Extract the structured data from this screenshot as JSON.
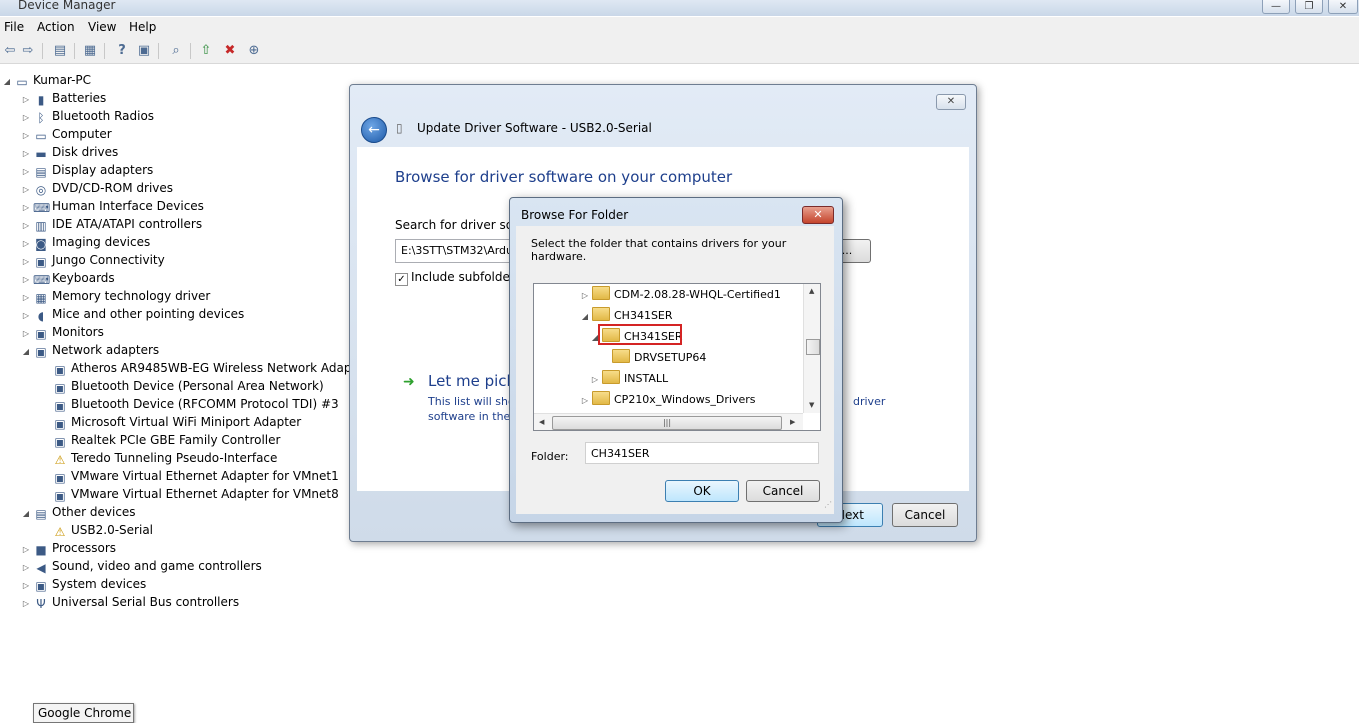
{
  "window": {
    "title": "Device Manager",
    "buttons": {
      "minimize": "—",
      "restore": "❐",
      "close": "✕"
    }
  },
  "menu": [
    "File",
    "Action",
    "View",
    "Help"
  ],
  "toolbar": {
    "icons": [
      "back-icon",
      "forward-icon",
      "properties-icon",
      "show-hidden-icon",
      "help-icon",
      "view-icon",
      "scan-hardware-icon",
      "update-driver-icon",
      "uninstall-icon",
      "enable-device-icon"
    ]
  },
  "tree": {
    "root": "Kumar-PC",
    "nodes": [
      {
        "label": "Batteries",
        "icon": "battery-icon",
        "expanded": false
      },
      {
        "label": "Bluetooth Radios",
        "icon": "bluetooth-icon",
        "expanded": false
      },
      {
        "label": "Computer",
        "icon": "computer-icon",
        "expanded": false
      },
      {
        "label": "Disk drives",
        "icon": "disk-drive-icon",
        "expanded": false
      },
      {
        "label": "Display adapters",
        "icon": "display-adapter-icon",
        "expanded": false
      },
      {
        "label": "DVD/CD-ROM drives",
        "icon": "dvd-drive-icon",
        "expanded": false
      },
      {
        "label": "Human Interface Devices",
        "icon": "hid-icon",
        "expanded": false
      },
      {
        "label": "IDE ATA/ATAPI controllers",
        "icon": "ide-controller-icon",
        "expanded": false
      },
      {
        "label": "Imaging devices",
        "icon": "camera-icon",
        "expanded": false
      },
      {
        "label": "Jungo Connectivity",
        "icon": "network-device-icon",
        "expanded": false
      },
      {
        "label": "Keyboards",
        "icon": "keyboard-icon",
        "expanded": false
      },
      {
        "label": "Memory technology driver",
        "icon": "memory-icon",
        "expanded": false
      },
      {
        "label": "Mice and other pointing devices",
        "icon": "mouse-icon",
        "expanded": false
      },
      {
        "label": "Monitors",
        "icon": "monitor-icon",
        "expanded": false
      },
      {
        "label": "Network adapters",
        "icon": "network-adapter-icon",
        "expanded": true,
        "children": [
          {
            "label": "Atheros AR9485WB-EG Wireless Network Adapter",
            "icon": "network-adapter-icon"
          },
          {
            "label": "Bluetooth Device (Personal Area Network)",
            "icon": "network-adapter-icon"
          },
          {
            "label": "Bluetooth Device (RFCOMM Protocol TDI) #3",
            "icon": "network-adapter-icon"
          },
          {
            "label": "Microsoft Virtual WiFi Miniport Adapter",
            "icon": "network-adapter-icon"
          },
          {
            "label": "Realtek PCIe GBE Family Controller",
            "icon": "network-adapter-icon"
          },
          {
            "label": "Teredo Tunneling Pseudo-Interface",
            "icon": "warning-device-icon"
          },
          {
            "label": "VMware Virtual Ethernet Adapter for VMnet1",
            "icon": "network-adapter-icon"
          },
          {
            "label": "VMware Virtual Ethernet Adapter for VMnet8",
            "icon": "network-adapter-icon"
          }
        ]
      },
      {
        "label": "Other devices",
        "icon": "other-devices-icon",
        "expanded": true,
        "children": [
          {
            "label": "USB2.0-Serial",
            "icon": "warning-device-icon"
          }
        ]
      },
      {
        "label": "Processors",
        "icon": "processor-icon",
        "expanded": false
      },
      {
        "label": "Sound, video and game controllers",
        "icon": "speaker-icon",
        "expanded": false
      },
      {
        "label": "System devices",
        "icon": "system-device-icon",
        "expanded": false
      },
      {
        "label": "Universal Serial Bus controllers",
        "icon": "usb-icon",
        "expanded": false
      }
    ]
  },
  "taskbar_tooltip": "Google Chrome",
  "update_dialog": {
    "title": "Update Driver Software - USB2.0-Serial",
    "heading": "Browse for driver software on your computer",
    "search_label": "Search for driver softw",
    "path_value": "E:\\3STT\\STM32\\Ardu",
    "browse_label": "...",
    "include_subfolders": "Include subfolders",
    "include_subfolders_checked": true,
    "let_me_pick": "Let me pick",
    "let_me_pick_sub1": "This list will sho",
    "let_me_pick_sub2": "software in the",
    "driver_fragment": "driver",
    "next": "Next",
    "cancel": "Cancel"
  },
  "browse_folder": {
    "title": "Browse For Folder",
    "description": "Select the folder that contains drivers for your hardware.",
    "folders": [
      {
        "label": "CDM-2.08.28-WHQL-Certified1",
        "level": 0,
        "expander": "collapsed"
      },
      {
        "label": "CH341SER",
        "level": 0,
        "expander": "expanded"
      },
      {
        "label": "CH341SER",
        "level": 1,
        "expander": "expanded",
        "selected": true
      },
      {
        "label": "DRVSETUP64",
        "level": 2,
        "expander": "none"
      },
      {
        "label": "INSTALL",
        "level": 1,
        "expander": "collapsed"
      },
      {
        "label": "CP210x_Windows_Drivers",
        "level": 0,
        "expander": "collapsed"
      }
    ],
    "folder_label": "Folder:",
    "folder_value": "CH341SER",
    "ok": "OK",
    "cancel": "Cancel"
  }
}
